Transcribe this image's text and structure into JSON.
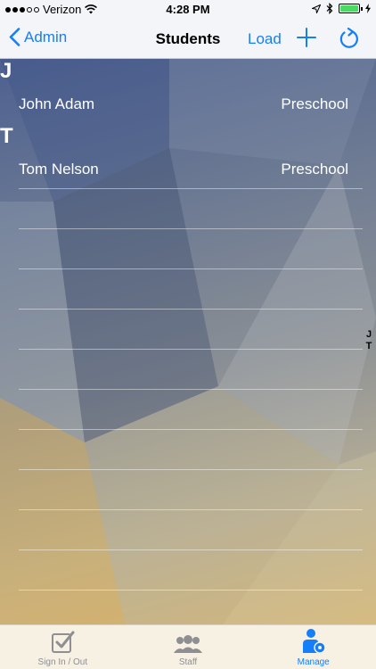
{
  "status_bar": {
    "carrier": "Verizon",
    "time": "4:28 PM",
    "signal_filled": 3,
    "signal_total": 5,
    "battery_level": 1.0
  },
  "nav": {
    "back_label": "Admin",
    "title": "Students",
    "load_label": "Load"
  },
  "sections": [
    {
      "letter": "J",
      "rows": [
        {
          "name": "John Adam",
          "grade": "Preschool"
        }
      ]
    },
    {
      "letter": "T",
      "rows": [
        {
          "name": "Tom Nelson",
          "grade": "Preschool"
        }
      ]
    }
  ],
  "index_letters": [
    "J",
    "T"
  ],
  "tabs": [
    {
      "label": "Sign In / Out",
      "icon": "checkbox-icon",
      "active": false
    },
    {
      "label": "Staff",
      "icon": "people-icon",
      "active": false
    },
    {
      "label": "Manage",
      "icon": "person-gear-icon",
      "active": true
    }
  ],
  "colors": {
    "accent": "#157efb",
    "battery": "#4cd964"
  }
}
